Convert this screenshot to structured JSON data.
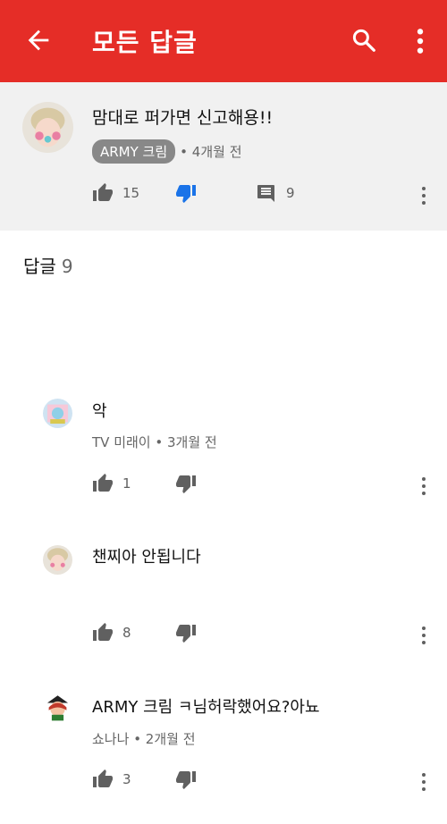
{
  "appbar": {
    "title": "모든 답글"
  },
  "parent": {
    "text": "맘대로 퍼가면 신고해용!!",
    "author": "ARMY 크림",
    "time": "• 4개월 전",
    "likes": "15",
    "replies": "9"
  },
  "replies_header": {
    "label": "답글",
    "count": "9"
  },
  "replies": [
    {
      "text": "악",
      "author": "TV 미래이",
      "time": "• 3개월 전",
      "likes": "1"
    },
    {
      "text": "챈찌아 안됩니다",
      "author": "",
      "time": "",
      "likes": "8"
    },
    {
      "text": "ARMY 크림 ㅋ님허락했어요?아뇨",
      "author": "쇼나나",
      "time": "• 2개월 전",
      "likes": "3"
    }
  ],
  "colors": {
    "appbar": "#e52d27",
    "dislike_active": "#1a73e8",
    "parent_bg": "#f1f1f1"
  }
}
